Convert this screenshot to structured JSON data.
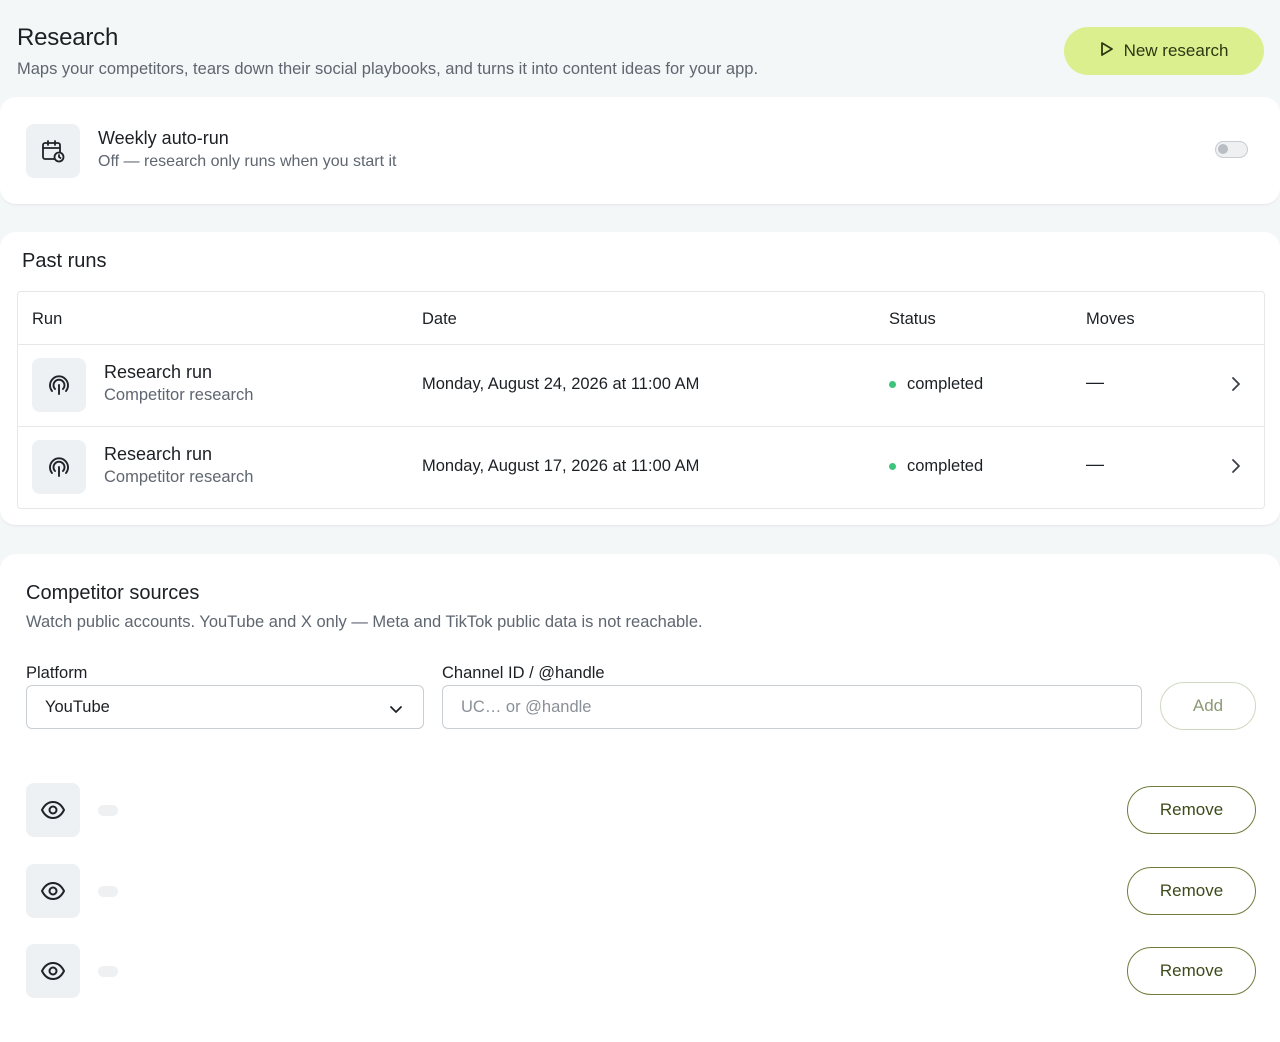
{
  "header": {
    "title": "Research",
    "subtitle": "Maps your competitors, tears down their social playbooks, and turns it into content ideas for your app.",
    "new_button_label": "New research",
    "new_button_icon": "play-icon"
  },
  "auto_run": {
    "icon": "calendar-clock-icon",
    "title": "Weekly auto-run",
    "subtitle": "Off — research only runs when you start it",
    "enabled": false
  },
  "past_runs": {
    "title": "Past runs",
    "columns": [
      "Run",
      "Date",
      "Status",
      "Moves"
    ],
    "rows": [
      {
        "icon": "fingerprint-icon",
        "title": "Research run",
        "subtitle": "Competitor research",
        "date": "Monday, August 24, 2026 at 11:00 AM",
        "status": "completed",
        "moves": "—"
      },
      {
        "icon": "fingerprint-icon",
        "title": "Research run",
        "subtitle": "Competitor research",
        "date": "Monday, August 17, 2026 at 11:00 AM",
        "status": "completed",
        "moves": "—"
      }
    ]
  },
  "sources": {
    "title": "Competitor sources",
    "subtitle": "Watch public accounts. YouTube and X only — Meta and TikTok public data is not reachable.",
    "platform_label": "Platform",
    "platform_value": "YouTube",
    "channel_label": "Channel ID / @handle",
    "channel_placeholder": "UC… or @handle",
    "channel_value": "",
    "add_label": "Add",
    "items": [
      {
        "icon": "eye-icon",
        "remove_label": "Remove"
      },
      {
        "icon": "eye-icon",
        "remove_label": "Remove"
      },
      {
        "icon": "eye-icon",
        "remove_label": "Remove"
      }
    ]
  },
  "colors": {
    "accent": "#dcef8f",
    "status_completed": "#3ec37a",
    "remove_border": "#6e7d3c"
  }
}
